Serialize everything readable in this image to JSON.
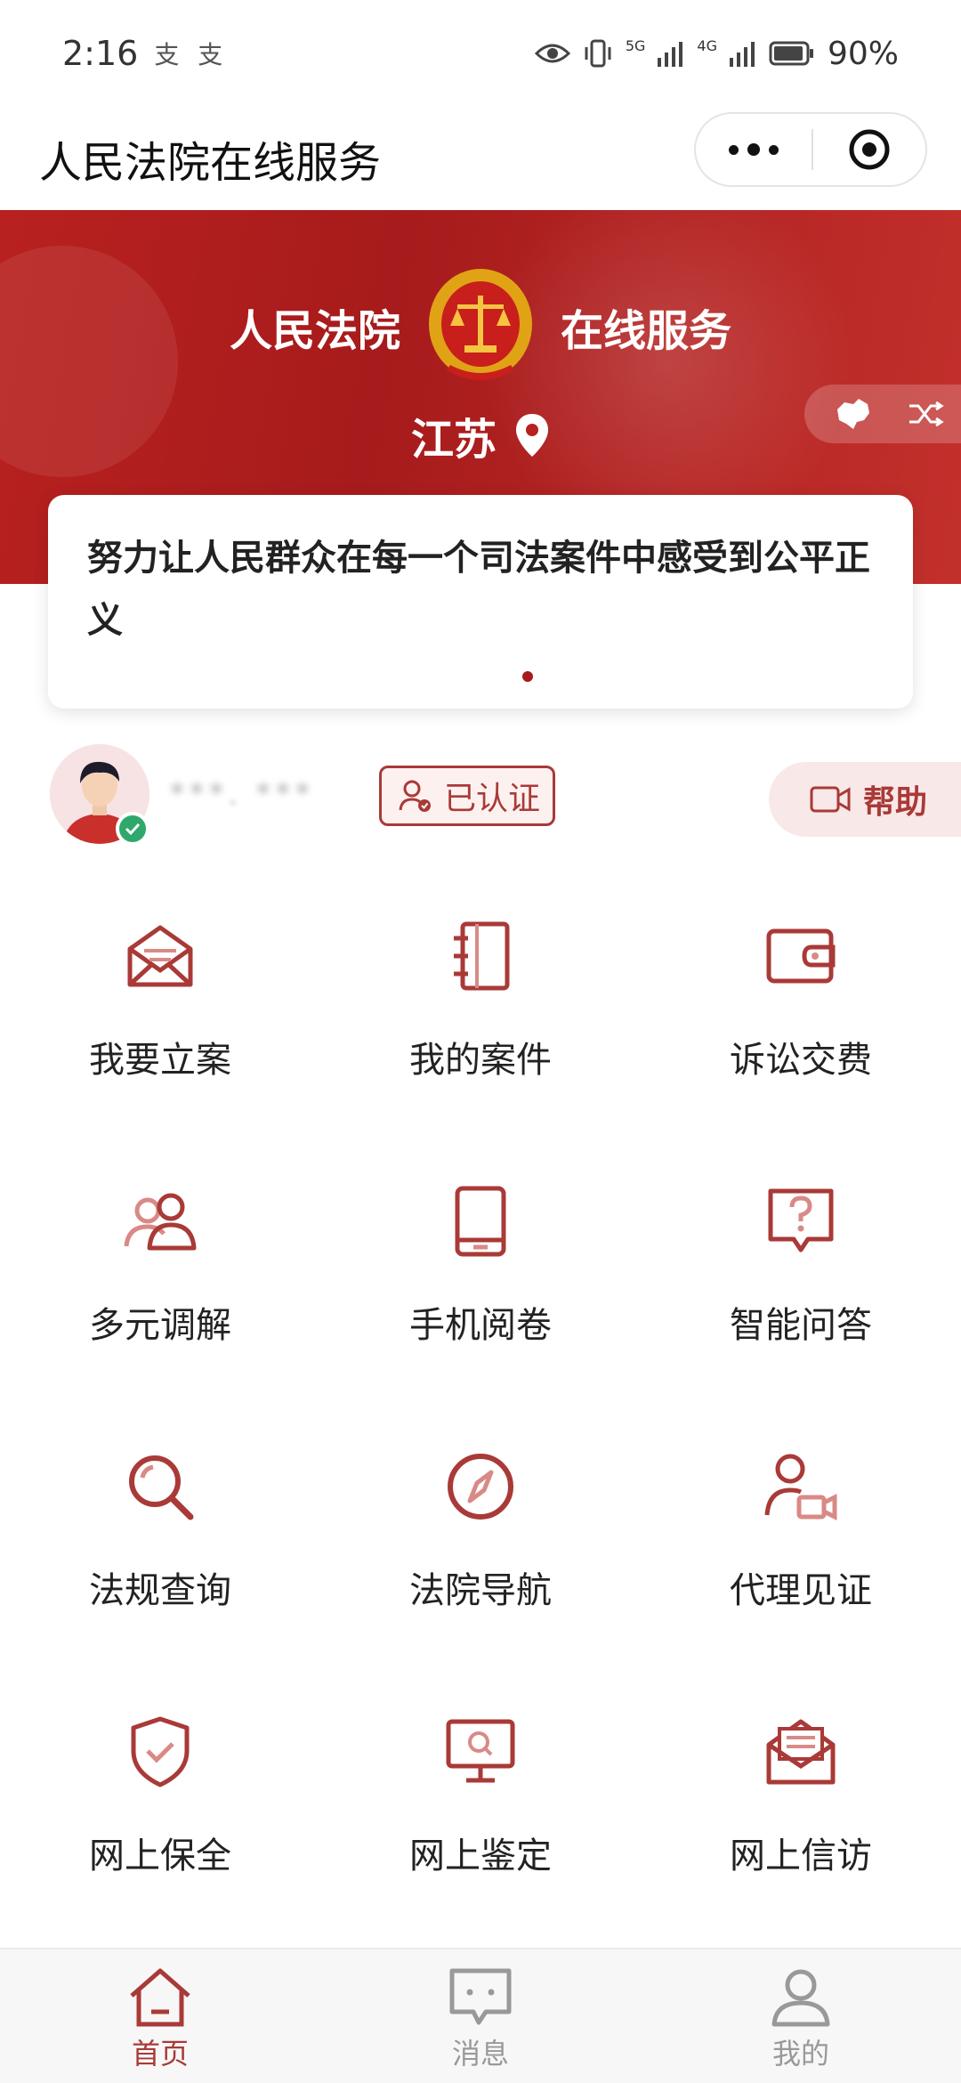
{
  "status_bar": {
    "time": "2:16",
    "notifications": "支 支",
    "network_5g": "5G",
    "network_4g": "4G",
    "battery": "90%"
  },
  "title_bar": {
    "title": "人民法院在线服务"
  },
  "banner": {
    "title_left": "人民法院",
    "title_right": "在线服务",
    "region": "江苏",
    "accent_color": "#a71b1c"
  },
  "slogan": {
    "text": "努力让人民群众在每一个司法案件中感受到公平正义"
  },
  "user": {
    "name": "***. ***",
    "verified_label": "已认证",
    "help_label": "帮助"
  },
  "services": [
    {
      "label": "我要立案",
      "icon": "envelope-open-icon"
    },
    {
      "label": "我的案件",
      "icon": "notebook-icon"
    },
    {
      "label": "诉讼交费",
      "icon": "wallet-icon"
    },
    {
      "label": "多元调解",
      "icon": "people-icon"
    },
    {
      "label": "手机阅卷",
      "icon": "tablet-icon"
    },
    {
      "label": "智能问答",
      "icon": "question-bubble-icon"
    },
    {
      "label": "法规查询",
      "icon": "search-icon"
    },
    {
      "label": "法院导航",
      "icon": "compass-icon"
    },
    {
      "label": "代理见证",
      "icon": "person-video-icon"
    },
    {
      "label": "网上保全",
      "icon": "shield-check-icon"
    },
    {
      "label": "网上鉴定",
      "icon": "monitor-search-icon"
    },
    {
      "label": "网上信访",
      "icon": "letter-icon"
    }
  ],
  "tabs": [
    {
      "label": "首页",
      "icon": "home-icon",
      "active": true
    },
    {
      "label": "消息",
      "icon": "message-icon",
      "active": false
    },
    {
      "label": "我的",
      "icon": "profile-icon",
      "active": false
    }
  ]
}
